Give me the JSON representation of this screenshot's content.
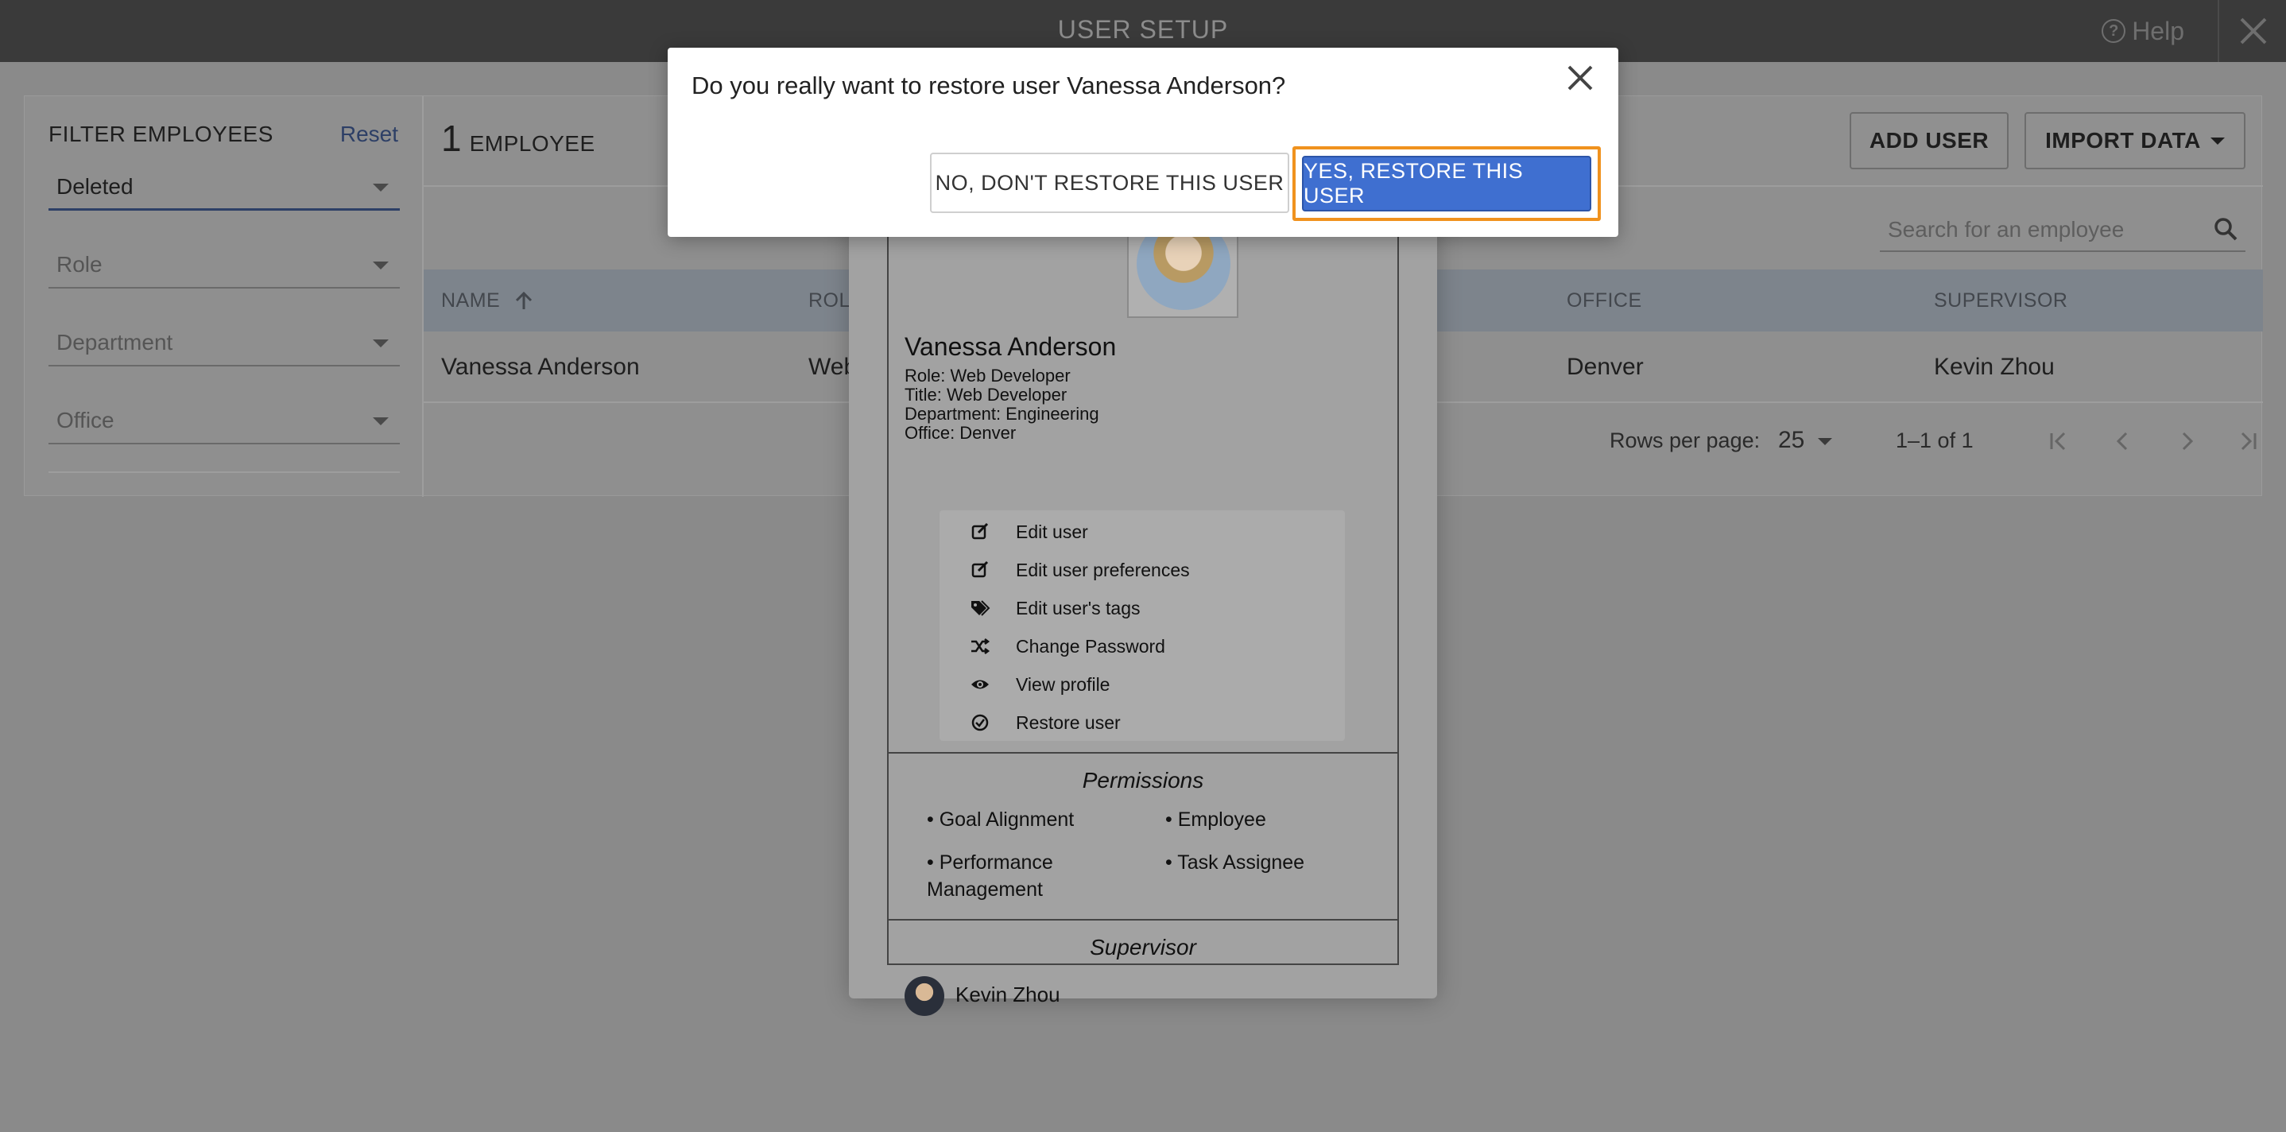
{
  "app": {
    "title": "USER SETUP",
    "help_label": "Help"
  },
  "filter": {
    "label": "FILTER EMPLOYEES",
    "reset": "Reset",
    "status_value": "Deleted",
    "role_placeholder": "Role",
    "department_placeholder": "Department",
    "office_placeholder": "Office"
  },
  "main": {
    "count": "1",
    "count_label": "EMPLOYEE",
    "add_user": "ADD USER",
    "import_data": "IMPORT DATA",
    "search_placeholder": "Search for an employee",
    "columns": [
      "NAME",
      "ROLE",
      "OFFICE",
      "SUPERVISOR"
    ],
    "rows": [
      {
        "name": "Vanessa Anderson",
        "role": "Web",
        "office": "Denver",
        "supervisor": "Kevin Zhou"
      }
    ],
    "rows_per_page_label": "Rows per page:",
    "rows_per_page": "25",
    "range": "1–1 of 1"
  },
  "card": {
    "name": "Vanessa Anderson",
    "role": "Role: Web Developer",
    "title": "Title: Web Developer",
    "department": "Department: Engineering",
    "office": "Office: Denver",
    "menu": [
      {
        "label": "Edit user",
        "icon": "edit-icon"
      },
      {
        "label": "Edit user preferences",
        "icon": "edit-icon"
      },
      {
        "label": "Edit user's tags",
        "icon": "tags-icon"
      },
      {
        "label": "Change Password",
        "icon": "shuffle-icon"
      },
      {
        "label": "View profile",
        "icon": "eye-icon"
      },
      {
        "label": "Restore user",
        "icon": "check-circle-icon"
      }
    ],
    "permissions_title": "Permissions",
    "permissions": [
      "• Goal Alignment",
      "• Employee",
      "• Performance Management",
      "• Task Assignee"
    ],
    "supervisor_title": "Supervisor",
    "supervisor_name": "Kevin Zhou"
  },
  "dialog": {
    "question": "Do you really want to restore user Vanessa Anderson?",
    "no_label": "NO, DON'T RESTORE THIS USER",
    "yes_label": "YES, RESTORE THIS USER"
  },
  "colors": {
    "accent": "#3f6fd0",
    "highlight": "#f0921e",
    "topbar": "#3a3a3a"
  }
}
